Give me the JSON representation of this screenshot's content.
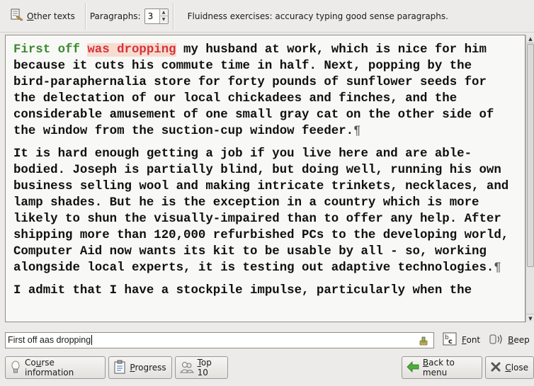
{
  "toolbar": {
    "other_texts_label_u": "O",
    "other_texts_label_rest": "ther texts",
    "paragraphs_label": "Paragraphs:",
    "paragraphs_value": "3",
    "exercise_title": "Fluidness exercises: accuracy typing good sense paragraphs."
  },
  "text": {
    "typed_correct": "First off",
    "typed_error": "was dropping",
    "p1_rest": " my husband at work, which is nice for him because it cuts his commute time in half. Next, popping by the bird-paraphernalia store for forty pounds of sunflower seeds for the delectation of our local chickadees and finches, and the considerable amusement of one small gray cat on the other side of the window from the suction-cup window feeder.",
    "p2": "It is hard enough getting a job if you live here and are able-bodied. Joseph is partially blind, but doing well, running his own business selling wool and making intricate trinkets, necklaces, and lamp shades. But he is the exception in a country which is more likely to shun the visually-impaired than to offer any help. After shipping more than 120,000 refurbished PCs to the developing world, Computer Aid now wants its kit to be usable by all - so, working alongside local experts, it is testing out adaptive technologies.",
    "p3": "I admit that I have a stockpile impulse, particularly when the",
    "pilcrow": "¶"
  },
  "input": {
    "value": "First off aas dropping"
  },
  "controls": {
    "font_label_u": "F",
    "font_label_rest": "ont",
    "beep_label_u": "B",
    "beep_label_rest": "eep"
  },
  "bottom": {
    "course_info_pre": "Co",
    "course_info_u": "u",
    "course_info_post": "rse information",
    "progress_pre": "",
    "progress_u": "P",
    "progress_post": "rogress",
    "top10_pre": "",
    "top10_u": "T",
    "top10_post": "op 10",
    "back_pre": "",
    "back_u": "B",
    "back_post": "ack to menu",
    "close_pre": "",
    "close_u": "C",
    "close_post": "lose"
  }
}
